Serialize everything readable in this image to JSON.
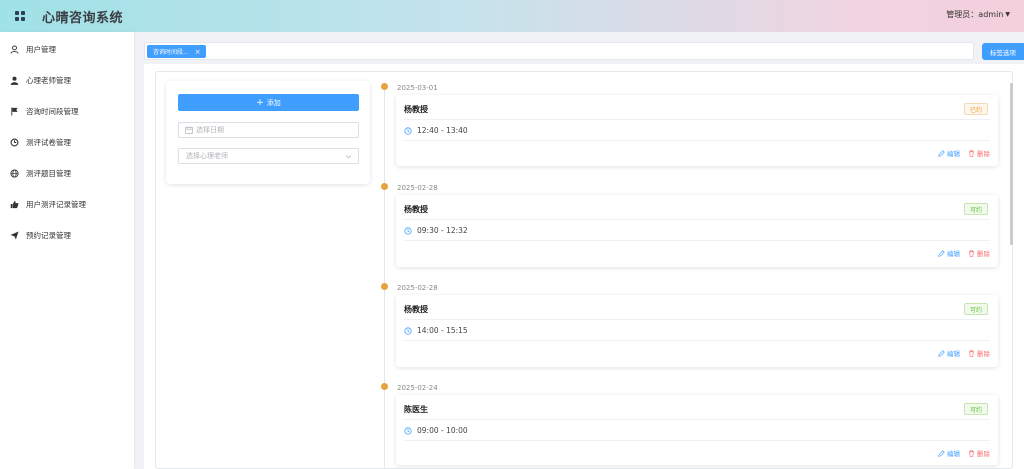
{
  "header": {
    "title": "心晴咨询系统",
    "admin_label": "管理员：admin"
  },
  "sidebar": {
    "items": [
      {
        "label": "用户管理",
        "icon": "user-outline-icon"
      },
      {
        "label": "心理老师管理",
        "icon": "user-filled-icon"
      },
      {
        "label": "咨询时间段管理",
        "icon": "flag-icon"
      },
      {
        "label": "测评试卷管理",
        "icon": "refresh-circle-icon"
      },
      {
        "label": "测评题目管理",
        "icon": "globe-icon"
      },
      {
        "label": "用户测评记录管理",
        "icon": "thumb-up-icon"
      },
      {
        "label": "预约记录管理",
        "icon": "send-icon"
      }
    ]
  },
  "tabs": {
    "active_tab": "咨询时间段...",
    "tag_options": "标签选项"
  },
  "filter": {
    "add_label": "添加",
    "date_placeholder": "选择日期",
    "teacher_placeholder": "选择心理老师"
  },
  "timeline": [
    {
      "date": "2025-03-01",
      "name": "杨教授",
      "time": "12:40 - 13:40",
      "status": "已约",
      "status_type": "booked",
      "edit": "编辑",
      "delete": "删除"
    },
    {
      "date": "2025-02-28",
      "name": "杨教授",
      "time": "09:30 - 12:32",
      "status": "可约",
      "status_type": "available",
      "edit": "编辑",
      "delete": "删除"
    },
    {
      "date": "2025-02-28",
      "name": "杨教授",
      "time": "14:00 - 15:15",
      "status": "可约",
      "status_type": "available",
      "edit": "编辑",
      "delete": "删除"
    },
    {
      "date": "2025-02-24",
      "name": "陈医生",
      "time": "09:00 - 10:00",
      "status": "可约",
      "status_type": "available",
      "edit": "编辑",
      "delete": "删除"
    }
  ],
  "colors": {
    "primary": "#409eff",
    "warning": "#e6a23c",
    "success": "#67c23a",
    "danger": "#f56c6c"
  }
}
